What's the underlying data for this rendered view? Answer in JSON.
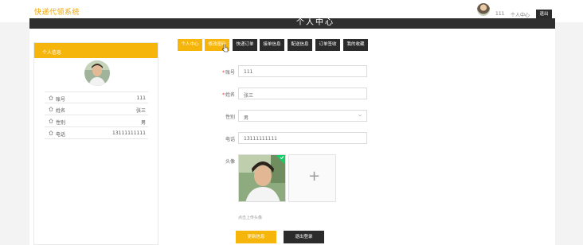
{
  "header": {
    "brand": "快递代领系统",
    "username": "111",
    "user_center": "个人中心",
    "logout": "退出"
  },
  "title_strip": "个人中心",
  "sidebar": {
    "heading": "个人信息",
    "rows": [
      {
        "icon": "home-icon",
        "label": "账号",
        "value": "111"
      },
      {
        "icon": "home-icon",
        "label": "姓名",
        "value": "张三"
      },
      {
        "icon": "home-icon",
        "label": "性别",
        "value": "男"
      },
      {
        "icon": "home-icon",
        "label": "电话",
        "value": "13111111111"
      }
    ]
  },
  "tabs": [
    {
      "label": "个人中心",
      "active": true
    },
    {
      "label": "修改密码",
      "active": true
    },
    {
      "label": "快递订单",
      "active": false
    },
    {
      "label": "接单信息",
      "active": false
    },
    {
      "label": "配送信息",
      "active": false
    },
    {
      "label": "订单签收",
      "active": false
    },
    {
      "label": "我的收藏",
      "active": false
    }
  ],
  "form": {
    "account_label": "账号",
    "account_value": "111",
    "name_label": "姓名",
    "name_value": "张三",
    "gender_label": "性别",
    "gender_value": "男",
    "phone_label": "电话",
    "phone_value": "13111111111",
    "avatar_label": "头像",
    "upload_hint": "点击上传头像",
    "plus": "+"
  },
  "buttons": {
    "update": "更新信息",
    "logout": "退出登录"
  },
  "colors": {
    "accent": "#f5b50a",
    "dark": "#2b2b2b",
    "success": "#13ce66"
  }
}
